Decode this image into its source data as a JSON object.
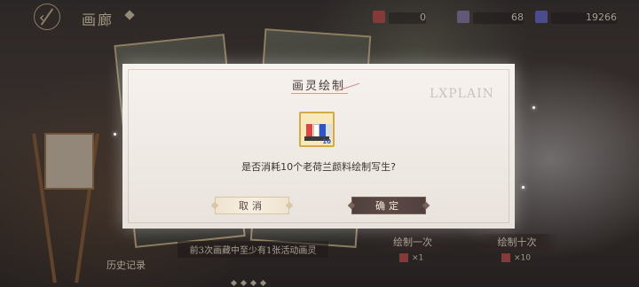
{
  "header": {
    "title": "画廊",
    "resources": [
      {
        "name": "resource-1",
        "value": "0"
      },
      {
        "name": "resource-2",
        "value": "68"
      },
      {
        "name": "resource-3",
        "value": "19266"
      }
    ]
  },
  "dialog": {
    "title": "画灵绘制",
    "watermark": "LXPLAIN",
    "item_count": "10",
    "message": "是否消耗10个老荷兰颜料绘制写生?",
    "cancel_label": "取消",
    "confirm_label": "确定"
  },
  "bottom": {
    "caption": "前3次画藏中至少有1张活动画灵",
    "history_label": "历史记录",
    "draw_once_label": "绘制一次",
    "draw_ten_label": "绘制十次",
    "cost_once": "×1",
    "cost_ten": "×10"
  },
  "icons": {
    "back": "back-arrow-icon",
    "item": "paint-tube-icon"
  }
}
